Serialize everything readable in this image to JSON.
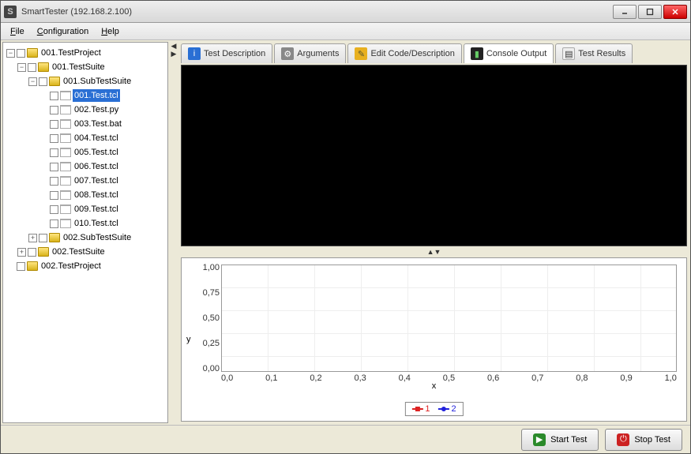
{
  "window": {
    "title": "SmartTester (192.168.2.100)"
  },
  "menu": {
    "file": "File",
    "configuration": "Configuration",
    "help": "Help"
  },
  "tree": {
    "project1": "001.TestProject",
    "suite1": "001.TestSuite",
    "subsuite1": "001.SubTestSuite",
    "tests": [
      "001.Test.tcl",
      "002.Test.py",
      "003.Test.bat",
      "004.Test.tcl",
      "005.Test.tcl",
      "006.Test.tcl",
      "007.Test.tcl",
      "008.Test.tcl",
      "009.Test.tcl",
      "010.Test.tcl"
    ],
    "subsuite2": "002.SubTestSuite",
    "suite2": "002.TestSuite",
    "project2": "002.TestProject",
    "selected": "001.Test.tcl"
  },
  "tabs": {
    "desc": "Test Description",
    "args": "Arguments",
    "edit": "Edit Code/Description",
    "console": "Console Output",
    "results": "Test Results"
  },
  "chart_data": {
    "type": "line",
    "title": "",
    "xlabel": "x",
    "ylabel": "y",
    "xlim": [
      0.0,
      1.0
    ],
    "ylim": [
      0.0,
      1.0
    ],
    "xticks": [
      "0,0",
      "0,1",
      "0,2",
      "0,3",
      "0,4",
      "0,5",
      "0,6",
      "0,7",
      "0,8",
      "0,9",
      "1,0"
    ],
    "yticks": [
      "1,00",
      "0,75",
      "0,50",
      "0,25",
      "0,00"
    ],
    "series": [
      {
        "name": "1",
        "color": "#d22",
        "marker": "square",
        "values": []
      },
      {
        "name": "2",
        "color": "#22d",
        "marker": "circle",
        "values": []
      }
    ]
  },
  "buttons": {
    "start": "Start Test",
    "stop": "Stop Test"
  }
}
